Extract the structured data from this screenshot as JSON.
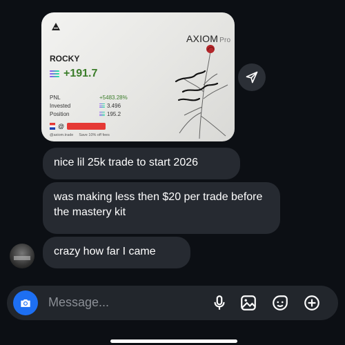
{
  "card": {
    "brand": "AXIOM",
    "brand_suffix": "Pro",
    "username": "ROCKY",
    "pnl_value": "+191.7",
    "stats": [
      {
        "label": "PNL",
        "value": "+5483.28%"
      },
      {
        "label": "Invested",
        "value": "3.496"
      },
      {
        "label": "Position",
        "value": "195.2"
      }
    ],
    "handle_prefix": "@",
    "footer_site": "@axiom.trade",
    "footer_promo": "Save 10% off fees",
    "colors": {
      "pnl_green": "#3b7d2a",
      "redaction": "#e53935"
    }
  },
  "messages": [
    {
      "text": "nice lil 25k trade to start 2026"
    },
    {
      "text": "was making less then $20 per trade before the mastery kit"
    },
    {
      "text": "crazy how far I came"
    }
  ],
  "composer": {
    "placeholder": "Message...",
    "icons": [
      "camera-icon",
      "mic-icon",
      "image-icon",
      "sticker-icon",
      "plus-icon"
    ],
    "camera_color": "#1d6ff2"
  }
}
